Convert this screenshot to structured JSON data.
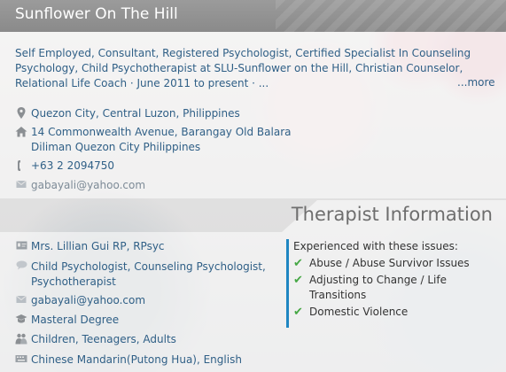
{
  "page": {
    "title": "Sunflower On The Hill"
  },
  "profile": {
    "description": "Self Employed, Consultant, Registered Psychologist, Certified Specialist In Counseling Psychology, Child Psychotherapist at SLU-Sunflower on the Hill, Christian Counselor, Relational Life Coach · June 2011 to present · ...",
    "more_link": "...more",
    "location": "Quezon City, Central Luzon, Philippines",
    "address_line1": "14 Commonwealth Avenue, Barangay Old Balara",
    "address_line2": "Diliman Quezon City Philippines",
    "phone": "+63 2 2094750",
    "email": "gabayali@yahoo.com"
  },
  "therapist": {
    "section_title": "Therapist Information",
    "name": "Mrs. Lillian Gui RP, RPsyc",
    "specialties_line1": "Child Psychologist, Counseling Psychologist,",
    "specialties_line2": "Psychotherapist",
    "email": "gabayali@yahoo.com",
    "degree": "Masteral Degree",
    "age_groups": "Children, Teenagers, Adults",
    "languages": "Chinese Mandarin(Putong Hua), English",
    "experience_title": "Experienced with these issues:",
    "issues": [
      {
        "line1": "Abuse / Abuse Survivor Issues",
        "line2": ""
      },
      {
        "line1": "Adjusting to Change / Life",
        "line2": "Transitions"
      },
      {
        "line1": "Domestic Violence",
        "line2": ""
      }
    ]
  },
  "icons": {
    "location": "map-pin-icon",
    "home": "home-icon",
    "phone": "phone-icon",
    "email": "envelope-icon",
    "id_card": "id-card-icon",
    "speech": "speech-bubble-icon",
    "graduation": "graduation-cap-icon",
    "people": "people-icon",
    "keyboard": "keyboard-icon",
    "check": "check-icon"
  },
  "colors": {
    "link": "#2f5f86",
    "titlebar": "#8f8f8f",
    "accent_bar": "#1f86c2",
    "check": "#45a744"
  }
}
